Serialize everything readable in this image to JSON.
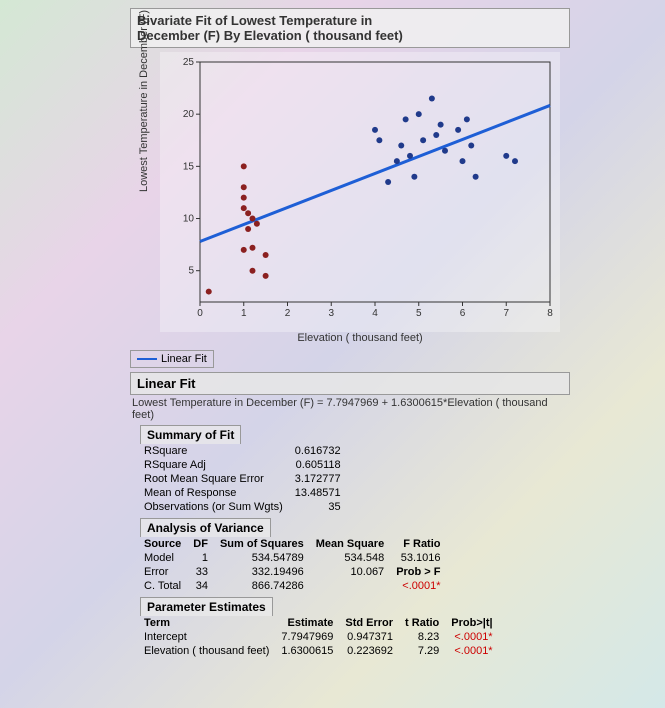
{
  "title_line1": "Bivariate Fit of Lowest Temperature in",
  "title_line2": "December (F) By Elevation ( thousand feet)",
  "ylabel": "Lowest Temperature in December (F)",
  "xlabel": "Elevation ( thousand feet)",
  "legend": "Linear Fit",
  "fit_head": "Linear Fit",
  "equation": "Lowest Temperature in December (F) = 7.7947969 + 1.6300615*Elevation ( thousand feet)",
  "summary_head": "Summary of Fit",
  "summary": [
    {
      "label": "RSquare",
      "val": "0.616732"
    },
    {
      "label": "RSquare Adj",
      "val": "0.605118"
    },
    {
      "label": "Root Mean Square Error",
      "val": "3.172777"
    },
    {
      "label": "Mean of Response",
      "val": "13.48571"
    },
    {
      "label": "Observations (or Sum Wgts)",
      "val": "35"
    }
  ],
  "anova_head": "Analysis of Variance",
  "anova_cols": {
    "c1": "Source",
    "c2": "DF",
    "c3": "Sum of Squares",
    "c4": "Mean Square",
    "c5": "F Ratio"
  },
  "anova": [
    {
      "src": "Model",
      "df": "1",
      "ss": "534.54789",
      "ms": "534.548",
      "f": "53.1016"
    },
    {
      "src": "Error",
      "df": "33",
      "ss": "332.19496",
      "ms": "10.067",
      "f": "Prob > F"
    },
    {
      "src": "C. Total",
      "df": "34",
      "ss": "866.74286",
      "ms": "",
      "f": "<.0001*"
    }
  ],
  "param_head": "Parameter Estimates",
  "param_cols": {
    "c1": "Term",
    "c2": "Estimate",
    "c3": "Std Error",
    "c4": "t Ratio",
    "c5": "Prob>|t|"
  },
  "params": [
    {
      "term": "Intercept",
      "est": "7.7947969",
      "se": "0.947371",
      "t": "8.23",
      "p": "<.0001*"
    },
    {
      "term": "Elevation ( thousand feet)",
      "est": "1.6300615",
      "se": "0.223692",
      "t": "7.29",
      "p": "<.0001*"
    }
  ],
  "chart_data": {
    "type": "scatter",
    "title": "Bivariate Fit of Lowest Temperature in December (F) By Elevation (thousand feet)",
    "xlabel": "Elevation ( thousand feet)",
    "ylabel": "Lowest Temperature in December (F)",
    "xlim": [
      0,
      8
    ],
    "ylim": [
      2,
      25
    ],
    "xticks": [
      0,
      1,
      2,
      3,
      4,
      5,
      6,
      7,
      8
    ],
    "yticks": [
      5,
      10,
      15,
      20,
      25
    ],
    "fit_line": {
      "intercept": 7.7947969,
      "slope": 1.6300615
    },
    "points": [
      {
        "x": 1.0,
        "y": 15.0
      },
      {
        "x": 1.0,
        "y": 13.0
      },
      {
        "x": 1.0,
        "y": 12.0
      },
      {
        "x": 1.0,
        "y": 11.0
      },
      {
        "x": 1.1,
        "y": 10.5
      },
      {
        "x": 1.2,
        "y": 10.0
      },
      {
        "x": 1.3,
        "y": 9.5
      },
      {
        "x": 1.1,
        "y": 9.0
      },
      {
        "x": 1.0,
        "y": 7.0
      },
      {
        "x": 1.2,
        "y": 7.2
      },
      {
        "x": 1.5,
        "y": 6.5
      },
      {
        "x": 1.2,
        "y": 5.0
      },
      {
        "x": 1.5,
        "y": 4.5
      },
      {
        "x": 0.2,
        "y": 3.0
      },
      {
        "x": 4.0,
        "y": 18.5
      },
      {
        "x": 4.1,
        "y": 17.5
      },
      {
        "x": 4.3,
        "y": 13.5
      },
      {
        "x": 4.5,
        "y": 15.5
      },
      {
        "x": 4.6,
        "y": 17.0
      },
      {
        "x": 4.7,
        "y": 19.5
      },
      {
        "x": 4.8,
        "y": 16.0
      },
      {
        "x": 4.9,
        "y": 14.0
      },
      {
        "x": 5.0,
        "y": 20.0
      },
      {
        "x": 5.1,
        "y": 17.5
      },
      {
        "x": 5.3,
        "y": 21.5
      },
      {
        "x": 5.4,
        "y": 18.0
      },
      {
        "x": 5.5,
        "y": 19.0
      },
      {
        "x": 5.6,
        "y": 16.5
      },
      {
        "x": 5.9,
        "y": 18.5
      },
      {
        "x": 6.0,
        "y": 15.5
      },
      {
        "x": 6.1,
        "y": 19.5
      },
      {
        "x": 6.2,
        "y": 17.0
      },
      {
        "x": 6.3,
        "y": 14.0
      },
      {
        "x": 7.0,
        "y": 16.0
      },
      {
        "x": 7.2,
        "y": 15.5
      }
    ]
  }
}
